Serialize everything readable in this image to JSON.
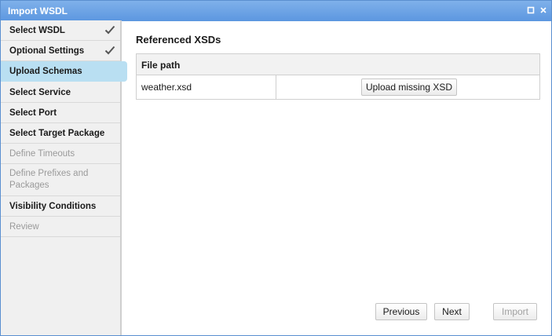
{
  "window": {
    "title": "Import WSDL",
    "maximize_icon": "maximize-icon",
    "close_icon": "close-icon"
  },
  "sidebar": {
    "items": [
      {
        "label": "Select WSDL",
        "state": "done"
      },
      {
        "label": "Optional Settings",
        "state": "done"
      },
      {
        "label": "Upload Schemas",
        "state": "active"
      },
      {
        "label": "Select Service",
        "state": "enabled"
      },
      {
        "label": "Select Port",
        "state": "enabled"
      },
      {
        "label": "Select Target Package",
        "state": "enabled"
      },
      {
        "label": "Define Timeouts",
        "state": "disabled"
      },
      {
        "label": "Define Prefixes and Packages",
        "state": "disabled"
      },
      {
        "label": "Visibility Conditions",
        "state": "enabled"
      },
      {
        "label": "Review",
        "state": "disabled"
      }
    ]
  },
  "main": {
    "section_title": "Referenced XSDs",
    "table": {
      "header": "File path",
      "rows": [
        {
          "file": "weather.xsd",
          "action": "Upload missing XSD"
        }
      ]
    }
  },
  "footer": {
    "previous": "Previous",
    "next": "Next",
    "import": "Import",
    "import_enabled": false
  },
  "colors": {
    "titlebar": "#5c97e0",
    "active_step": "#b9dff2",
    "check": "#555555"
  }
}
